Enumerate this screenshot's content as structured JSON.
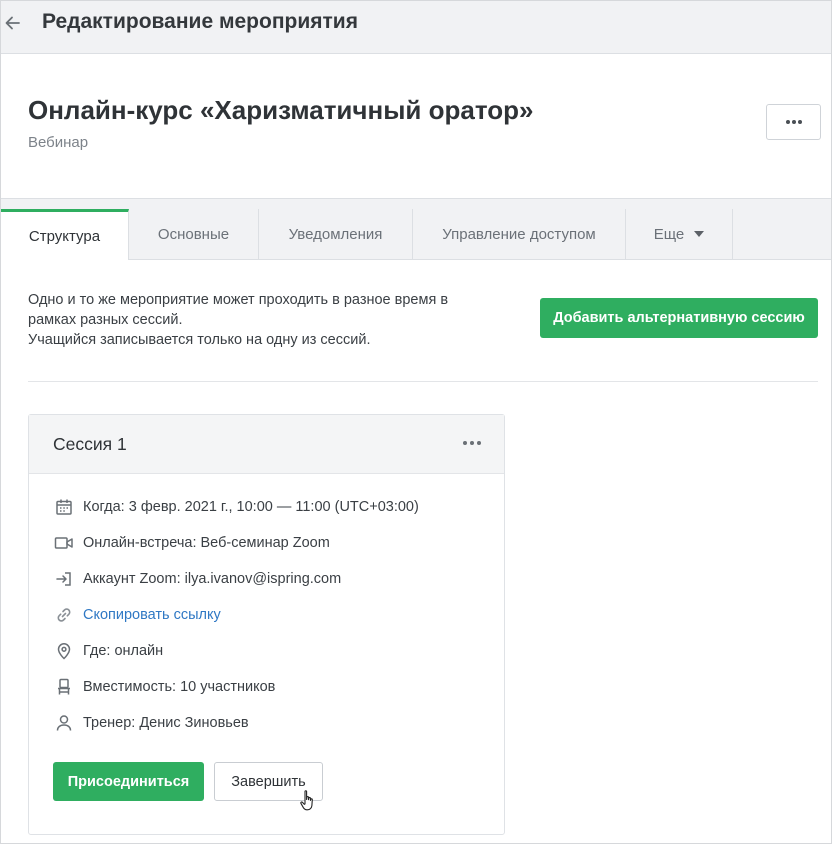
{
  "topbar": {
    "title": "Редактирование мероприятия"
  },
  "event": {
    "title": "Онлайн-курс «Харизматичный оратор»",
    "type": "Вебинар"
  },
  "tabs": [
    {
      "label": "Структура",
      "active": true
    },
    {
      "label": "Основные",
      "active": false
    },
    {
      "label": "Уведомления",
      "active": false
    },
    {
      "label": "Управление доступом",
      "active": false
    },
    {
      "label": "Еще",
      "active": false
    }
  ],
  "intro": {
    "line1": "Одно и то же мероприятие может проходить в разное время в",
    "line2": "рамках разных сессий.",
    "line3": "Учащийся записывается только на одну из сессий."
  },
  "add_session_label": "Добавить альтернативную сессию",
  "session": {
    "title": "Сессия 1",
    "details": {
      "when": "Когда: 3 февр. 2021 г., 10:00 — 11:00 (UTC+03:00)",
      "meeting": "Онлайн-встреча: Веб-семинар Zoom",
      "account": "Аккаунт Zoom: ilya.ivanov@ispring.com",
      "copy_link": "Скопировать ссылку",
      "where": "Где: онлайн",
      "capacity": "Вместимость: 10 участников",
      "trainer": "Тренер: Денис Зиновьев"
    },
    "join_label": "Присоединиться",
    "finish_label": "Завершить"
  },
  "colors": {
    "accent": "#2fae60",
    "link": "#2f78c4"
  }
}
